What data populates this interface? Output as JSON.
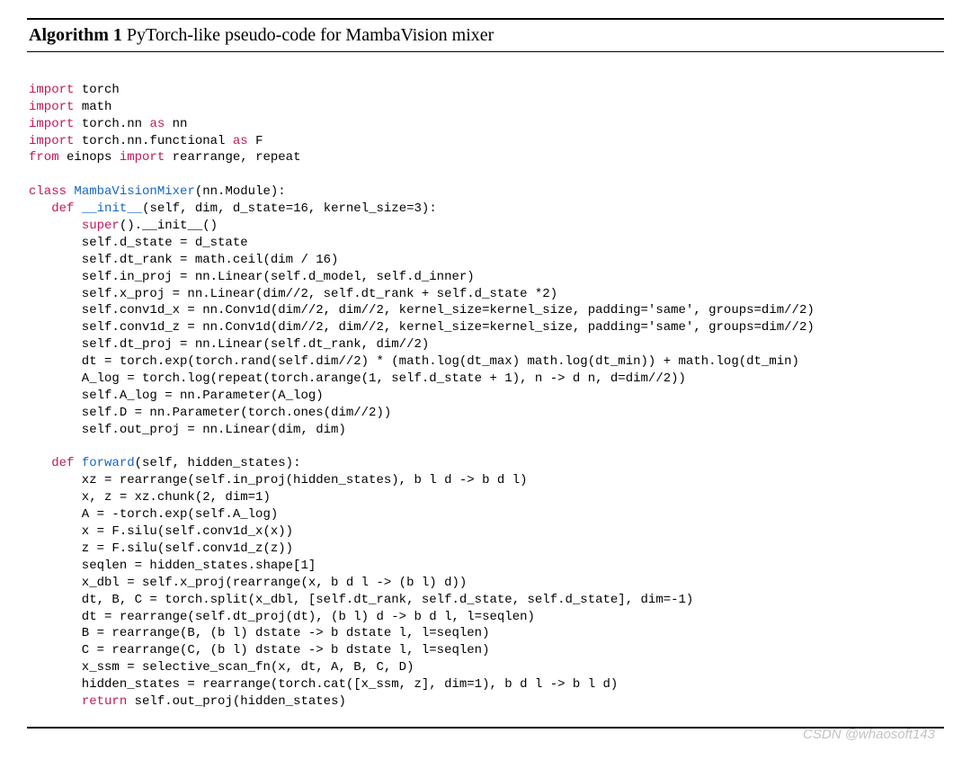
{
  "algorithm": {
    "label": "Algorithm 1",
    "caption": " PyTorch-like pseudo-code for MambaVision mixer"
  },
  "code": {
    "tokens": [
      [
        "\n"
      ],
      [
        {
          "c": "kw",
          "t": "import"
        },
        " torch\n"
      ],
      [
        {
          "c": "kw",
          "t": "import"
        },
        " math\n"
      ],
      [
        {
          "c": "kw",
          "t": "import"
        },
        " torch.nn ",
        {
          "c": "kw",
          "t": "as"
        },
        " nn\n"
      ],
      [
        {
          "c": "kw",
          "t": "import"
        },
        " torch.nn.functional ",
        {
          "c": "kw",
          "t": "as"
        },
        " F\n"
      ],
      [
        {
          "c": "kw",
          "t": "from"
        },
        " einops ",
        {
          "c": "kw",
          "t": "import"
        },
        " rearrange, repeat\n"
      ],
      [
        "\n"
      ],
      [
        {
          "c": "kw",
          "t": "class"
        },
        " ",
        {
          "c": "fn",
          "t": "MambaVisionMixer"
        },
        "(nn.Module):\n"
      ],
      [
        "   ",
        {
          "c": "kw",
          "t": "def"
        },
        " ",
        {
          "c": "fn",
          "t": "__init__"
        },
        "(self, dim, d_state=16, kernel_size=3):\n"
      ],
      [
        "       ",
        {
          "c": "kw",
          "t": "super"
        },
        "().__init__()\n"
      ],
      [
        "       self.d_state = d_state\n"
      ],
      [
        "       self.dt_rank = math.ceil(dim / 16)\n"
      ],
      [
        "       self.in_proj = nn.Linear(self.d_model, self.d_inner)\n"
      ],
      [
        "       self.x_proj = nn.Linear(dim//2, self.dt_rank + self.d_state *2)\n"
      ],
      [
        "       self.conv1d_x = nn.Conv1d(dim//2, dim//2, kernel_size=kernel_size, padding='same', groups=dim//2)\n"
      ],
      [
        "       self.conv1d_z = nn.Conv1d(dim//2, dim//2, kernel_size=kernel_size, padding='same', groups=dim//2)\n"
      ],
      [
        "       self.dt_proj = nn.Linear(self.dt_rank, dim//2)\n"
      ],
      [
        "       dt = torch.exp(torch.rand(self.dim//2) * (math.log(dt_max) math.log(dt_min)) + math.log(dt_min)\n"
      ],
      [
        "       A_log = torch.log(repeat(torch.arange(1, self.d_state + 1), n -> d n, d=dim//2))\n"
      ],
      [
        "       self.A_log = nn.Parameter(A_log)\n"
      ],
      [
        "       self.D = nn.Parameter(torch.ones(dim//2))\n"
      ],
      [
        "       self.out_proj = nn.Linear(dim, dim)\n"
      ],
      [
        "\n"
      ],
      [
        "   ",
        {
          "c": "kw",
          "t": "def"
        },
        " ",
        {
          "c": "fn",
          "t": "forward"
        },
        "(self, hidden_states):\n"
      ],
      [
        "       xz = rearrange(self.in_proj(hidden_states), b l d -> b d l)\n"
      ],
      [
        "       x, z = xz.chunk(2, dim=1)\n"
      ],
      [
        "       A = -torch.exp(self.A_log)\n"
      ],
      [
        "       x = F.silu(self.conv1d_x(x))\n"
      ],
      [
        "       z = F.silu(self.conv1d_z(z))\n"
      ],
      [
        "       seqlen = hidden_states.shape[1]\n"
      ],
      [
        "       x_dbl = self.x_proj(rearrange(x, b d l -> (b l) d))\n"
      ],
      [
        "       dt, B, C = torch.split(x_dbl, [self.dt_rank, self.d_state, self.d_state], dim=-1)\n"
      ],
      [
        "       dt = rearrange(self.dt_proj(dt), (b l) d -> b d l, l=seqlen)\n"
      ],
      [
        "       B = rearrange(B, (b l) dstate -> b dstate l, l=seqlen)\n"
      ],
      [
        "       C = rearrange(C, (b l) dstate -> b dstate l, l=seqlen)\n"
      ],
      [
        "       x_ssm = selective_scan_fn(x, dt, A, B, C, D)\n"
      ],
      [
        "       hidden_states = rearrange(torch.cat([x_ssm, z], dim=1), b d l -> b l d)\n"
      ],
      [
        "       ",
        {
          "c": "kw",
          "t": "return"
        },
        " self.out_proj(hidden_states)\n"
      ]
    ]
  },
  "watermark": "CSDN @whaosoft143"
}
